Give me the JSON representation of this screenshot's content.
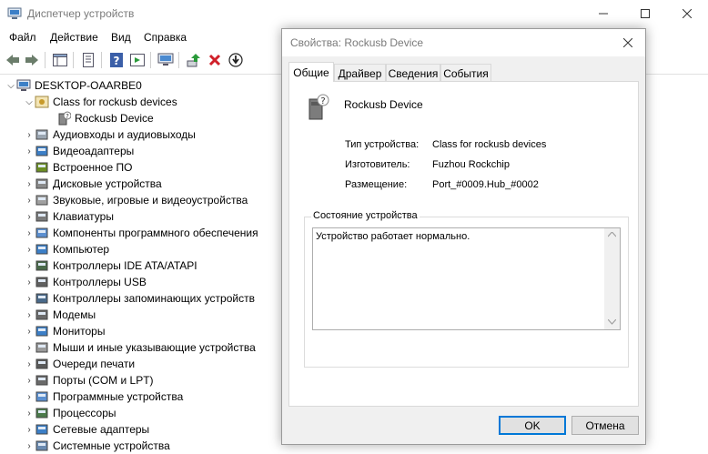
{
  "window": {
    "title": "Диспетчер устройств"
  },
  "menu": [
    "Файл",
    "Действие",
    "Вид",
    "Справка"
  ],
  "tree": {
    "root": "DESKTOP-OAARBE0",
    "expanded_group": "Class for rockusb devices",
    "expanded_child": "Rockusb Device",
    "categories": [
      "Аудиовходы и аудиовыходы",
      "Видеоадаптеры",
      "Встроенное ПО",
      "Дисковые устройства",
      "Звуковые, игровые и видеоустройства",
      "Клавиатуры",
      "Компоненты программного обеспечения",
      "Компьютер",
      "Контроллеры IDE ATA/ATAPI",
      "Контроллеры USB",
      "Контроллеры запоминающих устройств",
      "Модемы",
      "Мониторы",
      "Мыши и иные указывающие устройства",
      "Очереди печати",
      "Порты (COM и LPT)",
      "Программные устройства",
      "Процессоры",
      "Сетевые адаптеры",
      "Системные устройства"
    ]
  },
  "dialog": {
    "title": "Свойства: Rockusb Device",
    "tabs": [
      "Общие",
      "Драйвер",
      "Сведения",
      "События"
    ],
    "device_name": "Rockusb Device",
    "props": {
      "type_label": "Тип устройства:",
      "type_value": "Class for rockusb devices",
      "manufacturer_label": "Изготовитель:",
      "manufacturer_value": "Fuzhou Rockchip",
      "location_label": "Размещение:",
      "location_value": "Port_#0009.Hub_#0002"
    },
    "status_title": "Состояние устройства",
    "status_text": "Устройство работает нормально.",
    "ok_label": "OK",
    "cancel_label": "Отмена"
  }
}
